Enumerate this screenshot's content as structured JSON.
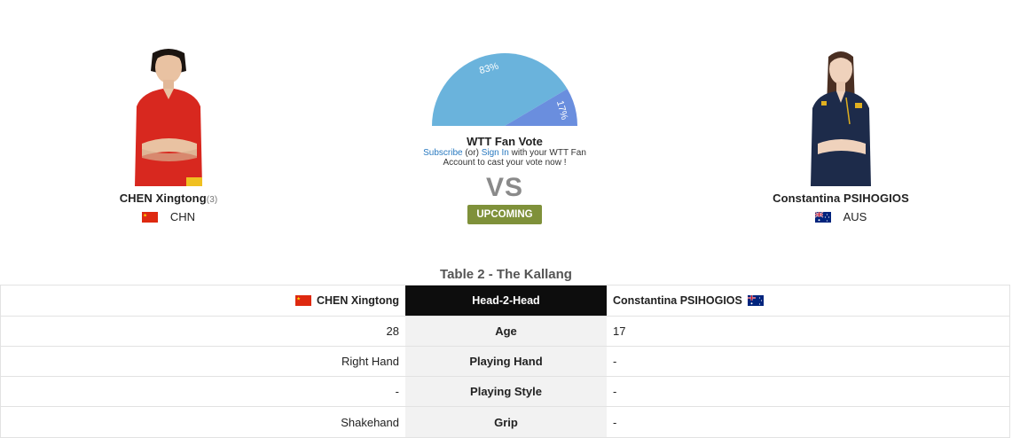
{
  "player_left": {
    "name": "CHEN Xingtong",
    "seed": "(3)",
    "country": "CHN",
    "flag_icon": "china-flag-icon"
  },
  "player_right": {
    "name": "Constantina PSIHOGIOS",
    "country": "AUS",
    "flag_icon": "australia-flag-icon"
  },
  "fan_vote": {
    "title": "WTT Fan Vote",
    "left_pct": "83%",
    "right_pct": "17%",
    "left_value": 83,
    "right_value": 17,
    "left_color": "#6ab3dc",
    "right_color": "#6a8ede",
    "subscribe_link": "Subscribe",
    "or_text": " (or) ",
    "signin_link": "Sign In",
    "rest_line1": " with your WTT Fan",
    "line2": "Account to cast your vote now !"
  },
  "vs_text": "VS",
  "status_badge": "UPCOMING",
  "status_color": "#7f913a",
  "venue": "Table 2 - The Kallang",
  "h2h": {
    "header": {
      "left": "CHEN Xingtong",
      "middle": "Head-2-Head",
      "right": "Constantina PSIHOGIOS"
    },
    "rows": [
      {
        "left": "28",
        "label": "Age",
        "right": "17"
      },
      {
        "left": "Right Hand",
        "label": "Playing Hand",
        "right": "-"
      },
      {
        "left": "-",
        "label": "Playing Style",
        "right": "-"
      },
      {
        "left": "Shakehand",
        "label": "Grip",
        "right": "-"
      }
    ]
  }
}
